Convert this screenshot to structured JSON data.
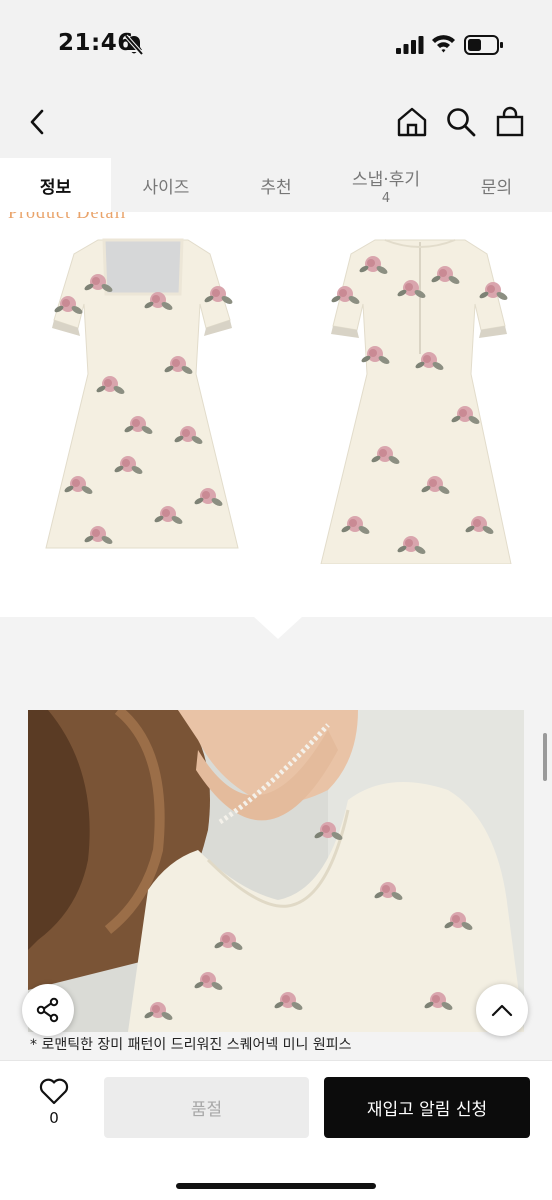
{
  "status_bar": {
    "time": "21:46",
    "icons": [
      "bell-slash-icon",
      "signal-icon",
      "wifi-icon",
      "battery-icon"
    ]
  },
  "nav": {
    "icons": [
      "back-chevron-icon",
      "home-icon",
      "search-icon",
      "shopping-bag-icon"
    ]
  },
  "tabs": [
    {
      "label": "정보",
      "active": true
    },
    {
      "label": "사이즈",
      "active": false
    },
    {
      "label": "추천",
      "active": false
    },
    {
      "label": "스냅·후기",
      "count": "4",
      "active": false
    },
    {
      "label": "문의",
      "active": false
    }
  ],
  "content": {
    "cropped_heading": "Product Detail",
    "caption": "* 로맨틱한 장미 패턴이 드리워진 스퀘어넥 미니 원피스"
  },
  "floating": {
    "share_icon": "share-icon",
    "top_icon": "chevron-up-icon"
  },
  "bottom_bar": {
    "like_count": "0",
    "soldout_label": "품절",
    "restock_label": "재입고 알림 신청"
  },
  "colors": {
    "header_bg": "#f2f2f2",
    "accent_black": "#0c0c0c",
    "dress_cream": "#f4efe1",
    "rose_pink": "#d9a5ad"
  }
}
